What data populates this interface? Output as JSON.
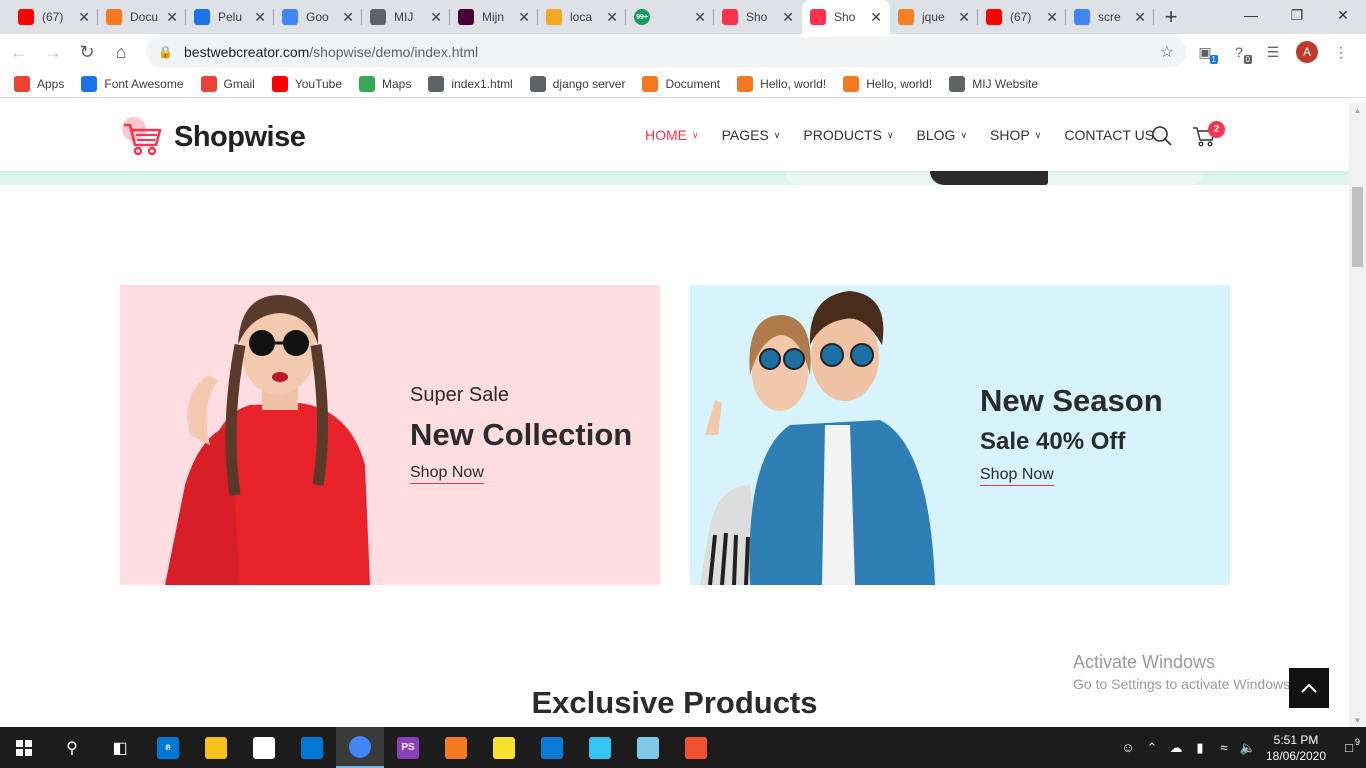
{
  "browser": {
    "tabs": [
      {
        "title": "(67)",
        "favicon_color": "#ff0000",
        "favicon": "yt-icon"
      },
      {
        "title": "Docu",
        "favicon_color": "#f47920",
        "favicon": "xampp-icon"
      },
      {
        "title": "Pelu",
        "favicon_color": "#1a73e8",
        "favicon": "shield-icon"
      },
      {
        "title": "Goo",
        "favicon_color": "#4285f4",
        "favicon": "google-icon"
      },
      {
        "title": "MIJ",
        "favicon_color": "#5f6368",
        "favicon": "globe-icon"
      },
      {
        "title": "Mijn",
        "favicon_color": "#470137",
        "favicon": "xd-icon"
      },
      {
        "title": "loca",
        "favicon_color": "#f5a623",
        "favicon": "pma-icon"
      },
      {
        "title": "",
        "favicon_color": "#0f9d58",
        "favicon": "badge-99-icon",
        "badge": "99+"
      },
      {
        "title": "Sho",
        "favicon_color": "#ff324d",
        "favicon": "cart-icon"
      },
      {
        "title": "Sho",
        "favicon_color": "#ff324d",
        "favicon": "cart-icon",
        "active": true
      },
      {
        "title": "jque",
        "favicon_color": "#f48024",
        "favicon": "stackoverflow-icon"
      },
      {
        "title": "(67)",
        "favicon_color": "#ff0000",
        "favicon": "yt-icon"
      },
      {
        "title": "scre",
        "favicon_color": "#4285f4",
        "favicon": "google-icon"
      }
    ],
    "url_host": "bestwebcreator.com",
    "url_path": "/shopwise/demo/index.html",
    "profile_initial": "A",
    "ext_badges": [
      "1",
      "0"
    ],
    "bookmarks": [
      {
        "label": "Apps",
        "icon": "apps-grid-icon",
        "color": "#ea4335"
      },
      {
        "label": "Font Awesome",
        "icon": "flag-icon",
        "color": "#1a73e8"
      },
      {
        "label": "Gmail",
        "icon": "gmail-icon",
        "color": "#ea4335"
      },
      {
        "label": "YouTube",
        "icon": "yt-icon",
        "color": "#ff0000"
      },
      {
        "label": "Maps",
        "icon": "maps-pin-icon",
        "color": "#34a853"
      },
      {
        "label": "index1.html",
        "icon": "globe-icon",
        "color": "#5f6368"
      },
      {
        "label": "django server",
        "icon": "globe-icon",
        "color": "#5f6368"
      },
      {
        "label": "Document",
        "icon": "xampp-icon",
        "color": "#f47920"
      },
      {
        "label": "Hello, world!",
        "icon": "xampp-icon",
        "color": "#f47920"
      },
      {
        "label": "Hello, world!",
        "icon": "xampp-icon",
        "color": "#f47920"
      },
      {
        "label": "MIJ Website",
        "icon": "globe-icon",
        "color": "#5f6368"
      }
    ]
  },
  "site": {
    "brand": "Shopwise",
    "accent": "#ff324d",
    "nav": [
      {
        "label": "HOME",
        "active": true
      },
      {
        "label": "PAGES"
      },
      {
        "label": "PRODUCTS"
      },
      {
        "label": "BLOG"
      },
      {
        "label": "SHOP"
      },
      {
        "label": "CONTACT US",
        "no_chevron": true
      }
    ],
    "cart_count": "2",
    "banner_left": {
      "sub": "Super Sale",
      "title": "New Collection",
      "cta": "Shop Now",
      "bg": "#ffdde1"
    },
    "banner_right": {
      "title": "New Season",
      "sub": "Sale 40% Off",
      "cta": "Shop Now",
      "bg": "#d7f3fb"
    },
    "section_title": "Exclusive Products"
  },
  "os": {
    "watermark_title": "Activate Windows",
    "watermark_sub": "Go to Settings to activate Windows.",
    "clock_time": "5:51 PM",
    "clock_date": "18/06/2020",
    "notif_count": "9",
    "taskbar_apps": [
      {
        "name": "edge-icon",
        "color": "#0078d7",
        "glyph": "e"
      },
      {
        "name": "file-explorer-icon",
        "color": "#f8c21c",
        "glyph": ""
      },
      {
        "name": "store-icon",
        "color": "#ffffff",
        "glyph": ""
      },
      {
        "name": "mail-icon",
        "color": "#0078d7",
        "glyph": ""
      },
      {
        "name": "chrome-icon",
        "color": "#4285f4",
        "glyph": "",
        "active": true
      },
      {
        "name": "phpstorm-icon",
        "color": "#8c3fb8",
        "glyph": "PS"
      },
      {
        "name": "xampp-icon",
        "color": "#f47920",
        "glyph": ""
      },
      {
        "name": "sticky-notes-icon",
        "color": "#f9e02d",
        "glyph": ""
      },
      {
        "name": "vscode-icon",
        "color": "#0a7bd6",
        "glyph": ""
      },
      {
        "name": "slack-icon",
        "color": "#36c5f0",
        "glyph": ""
      },
      {
        "name": "app-icon",
        "color": "#7ec7e6",
        "glyph": ""
      },
      {
        "name": "git-icon",
        "color": "#f05133",
        "glyph": ""
      }
    ]
  }
}
